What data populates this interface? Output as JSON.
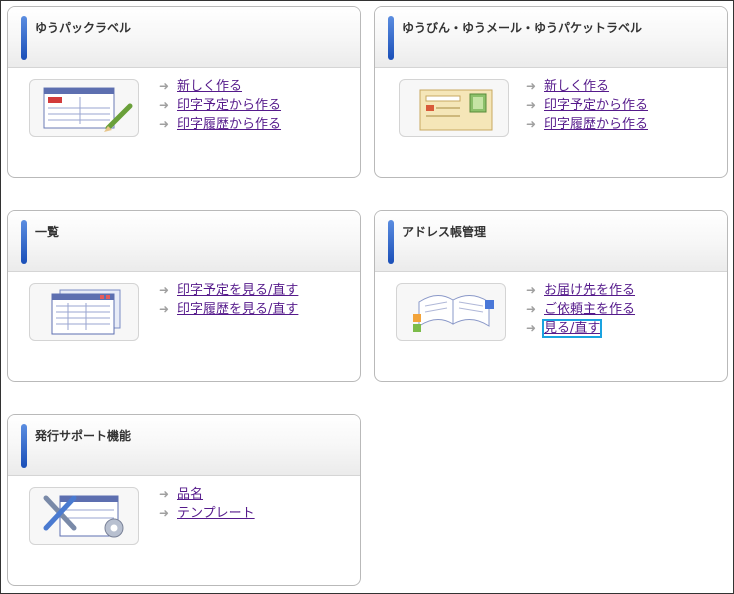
{
  "panels": [
    {
      "title": "ゆうパックラベル",
      "thumb_icon": "yupack-label-icon",
      "links": [
        "新しく作る",
        "印字予定から作る",
        "印字履歴から作る"
      ]
    },
    {
      "title": "ゆうびん・ゆうメール・ゆうパケットラベル",
      "thumb_icon": "yubin-label-icon",
      "links": [
        "新しく作る",
        "印字予定から作る",
        "印字履歴から作る"
      ]
    },
    {
      "title": "一覧",
      "thumb_icon": "list-window-icon",
      "links": [
        "印字予定を見る/直す",
        "印字履歴を見る/直す"
      ]
    },
    {
      "title": "アドレス帳管理",
      "thumb_icon": "address-book-icon",
      "links": [
        "お届け先を作る",
        "ご依頼主を作る",
        "見る/直す"
      ],
      "focused_link_index": 2
    },
    {
      "title": "発行サポート機能",
      "thumb_icon": "tools-settings-icon",
      "links": [
        "品名",
        "テンプレート"
      ]
    }
  ],
  "colors": {
    "link": "#551a8b",
    "accent_bar": "#1a4fb8",
    "focus_outline": "#1aa3e0"
  },
  "icons": {
    "link_arrow": "➜"
  }
}
